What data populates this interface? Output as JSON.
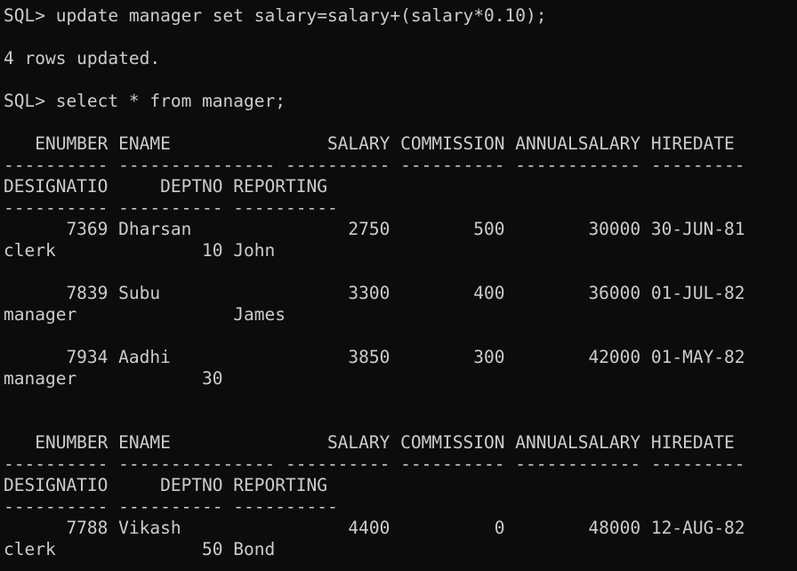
{
  "terminal": {
    "lines": [
      "SQL> update manager set salary=salary+(salary*0.10);",
      "",
      "4 rows updated.",
      "",
      "SQL> select * from manager;",
      "",
      "   ENUMBER ENAME               SALARY COMMISSION ANNUALSALARY HIREDATE",
      "---------- --------------- ---------- ---------- ------------ ---------",
      "DESIGNATIO     DEPTNO REPORTING",
      "---------- ---------- ----------",
      "      7369 Dharsan               2750        500        30000 30-JUN-81",
      "clerk              10 John",
      "",
      "      7839 Subu                  3300        400        36000 01-JUL-82",
      "manager               James",
      "",
      "      7934 Aadhi                 3850        300        42000 01-MAY-82",
      "manager            30",
      "",
      "",
      "   ENUMBER ENAME               SALARY COMMISSION ANNUALSALARY HIREDATE",
      "---------- --------------- ---------- ---------- ------------ ---------",
      "DESIGNATIO     DEPTNO REPORTING",
      "---------- ---------- ----------",
      "      7788 Vikash                4400          0        48000 12-AUG-82",
      "clerk              50 Bond"
    ]
  }
}
